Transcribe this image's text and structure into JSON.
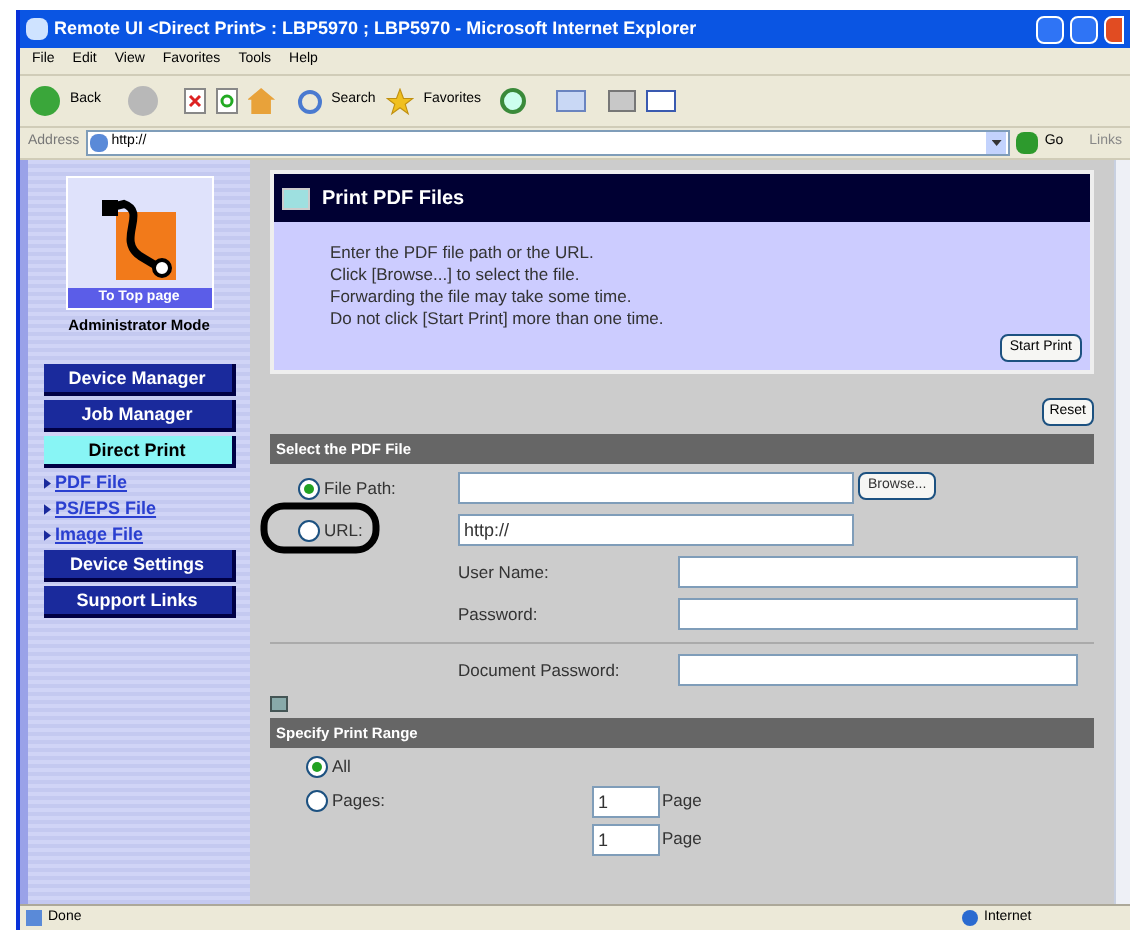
{
  "window": {
    "title": "Remote UI <Direct Print> : LBP5970 ; LBP5970 - Microsoft Internet Explorer"
  },
  "menu": [
    "File",
    "Edit",
    "View",
    "Favorites",
    "Tools",
    "Help"
  ],
  "toolbar": {
    "back": "Back",
    "search": "Search",
    "favorites": "Favorites"
  },
  "address": {
    "label": "Address",
    "value": "http://",
    "go": "Go",
    "links": "Links"
  },
  "sidebar": {
    "top_page": "To Top page",
    "mode": "Administrator Mode",
    "items": [
      {
        "label": "Device Manager",
        "kind": "button",
        "selected": false
      },
      {
        "label": "Job Manager",
        "kind": "button",
        "selected": false
      },
      {
        "label": "Direct Print",
        "kind": "button",
        "selected": true
      },
      {
        "label": "PDF File",
        "kind": "link",
        "selected": false
      },
      {
        "label": "PS/EPS File",
        "kind": "link",
        "selected": false
      },
      {
        "label": "Image File",
        "kind": "link",
        "selected": false
      },
      {
        "label": "Device Settings",
        "kind": "button",
        "selected": false
      },
      {
        "label": "Support Links",
        "kind": "button",
        "selected": false
      }
    ]
  },
  "panel": {
    "title": "Print PDF Files",
    "lines": [
      "Enter the PDF file path or the URL.",
      "Click [Browse...] to select the file.",
      "Forwarding the file may take some time.",
      "Do not click [Start Print] more than one time."
    ],
    "start_button": "Start Print"
  },
  "reset_button": "Reset",
  "file_section": {
    "title": "Select the PDF File",
    "sources": [
      {
        "label": "File Path:",
        "selected": true,
        "browse": "Browse..."
      },
      {
        "label": "URL:",
        "selected": false,
        "value": "http://"
      }
    ],
    "user_name": "User Name:",
    "password": "Password:",
    "document_password": "Document Password:"
  },
  "range_section": {
    "title": "Specify Print Range",
    "options": [
      {
        "label": "All",
        "selected": true
      },
      {
        "label": "Pages:",
        "selected": false
      }
    ],
    "from": {
      "value": "1",
      "unit": "Page"
    },
    "to": {
      "value": "1",
      "unit": "Page"
    }
  },
  "status_bar": {
    "text": "Done",
    "zone": "Internet"
  }
}
